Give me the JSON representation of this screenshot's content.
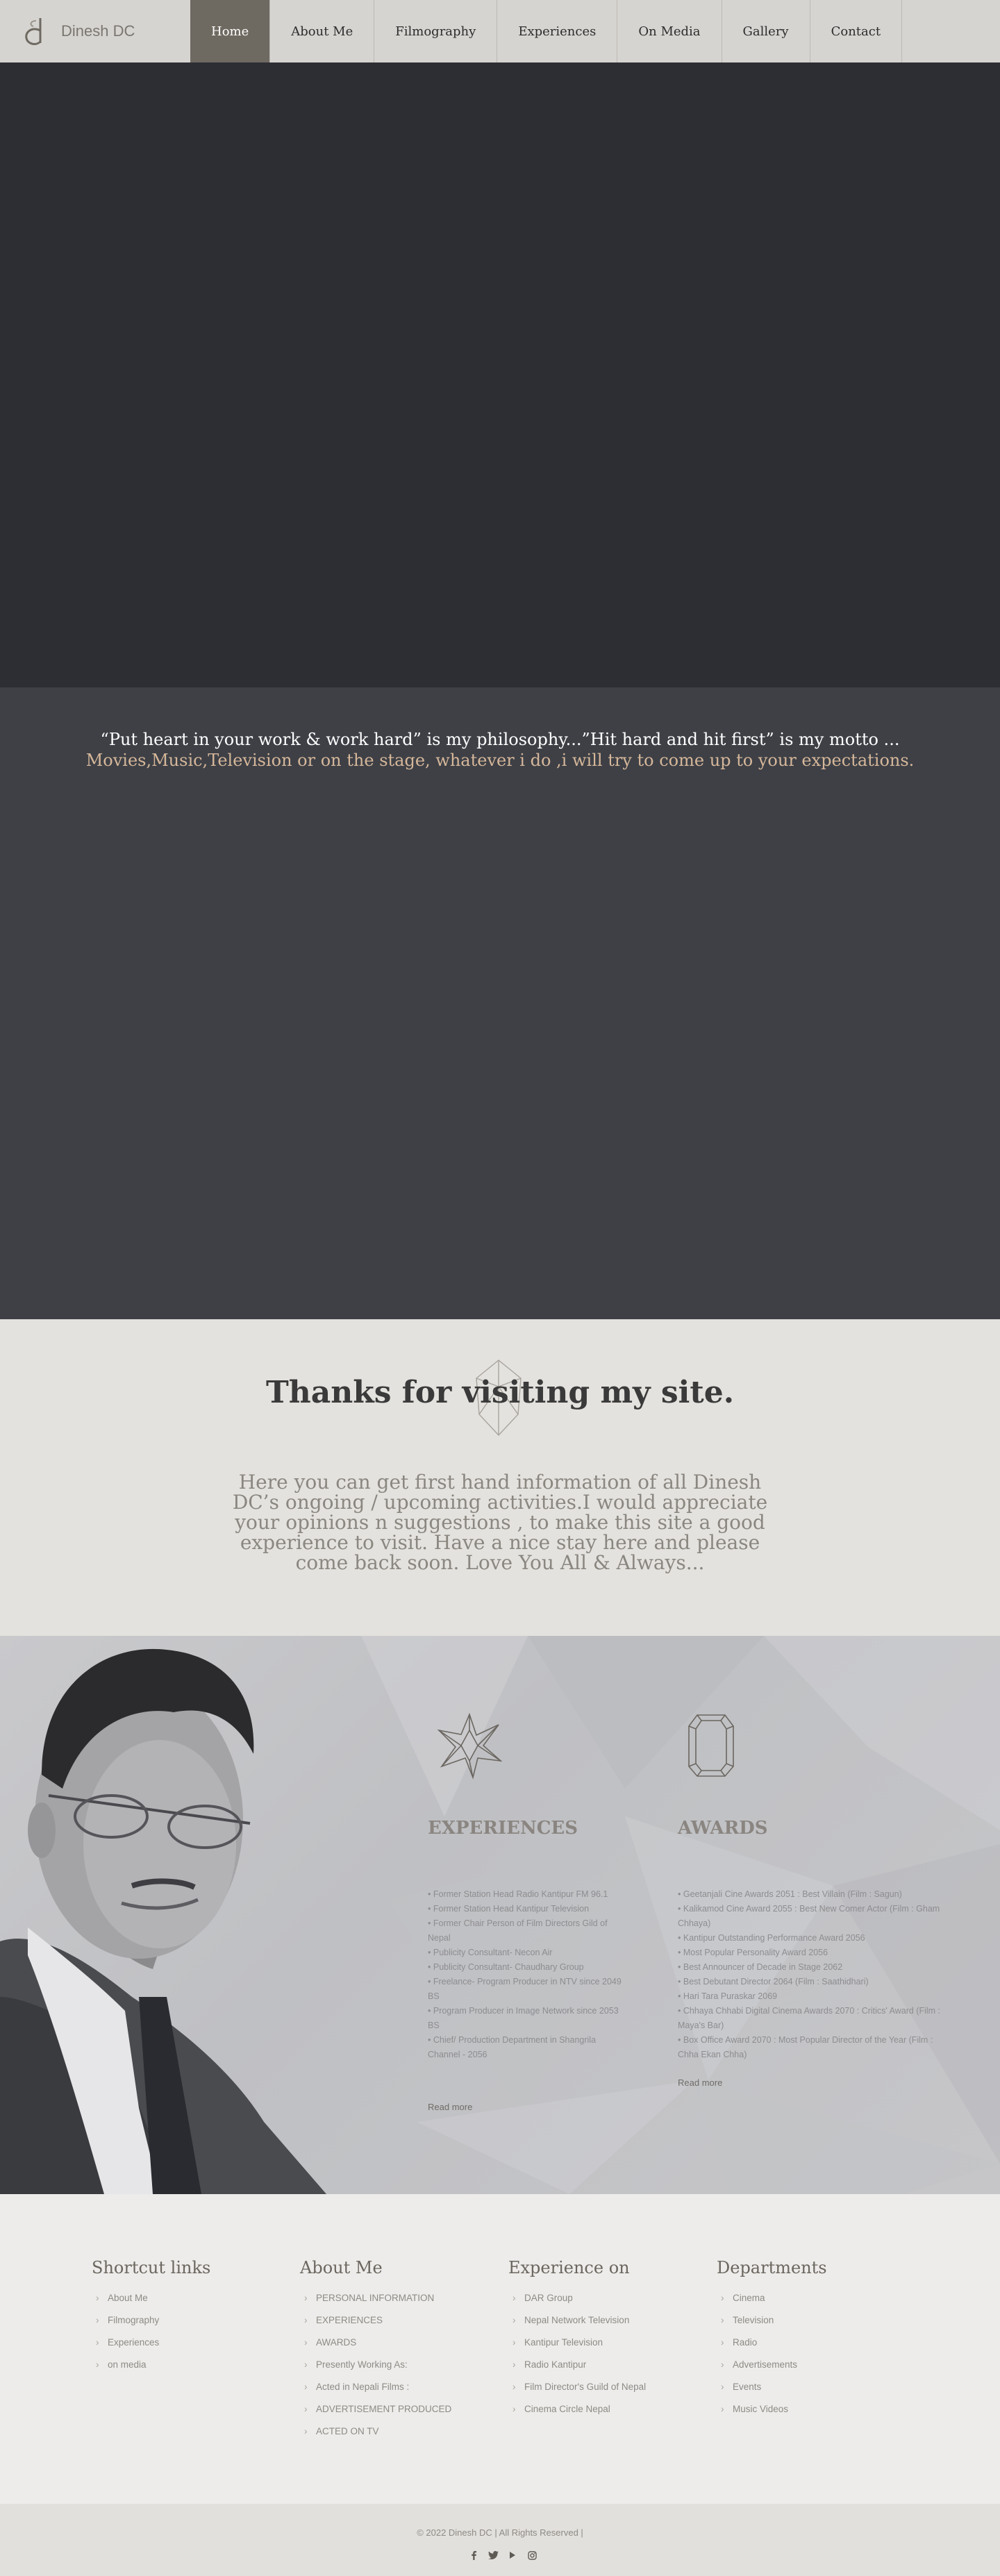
{
  "brand": {
    "name": "Dinesh DC",
    "logo_icon": "dc-monogram-icon"
  },
  "nav": {
    "items": [
      {
        "label": "Home",
        "active": true
      },
      {
        "label": "About Me"
      },
      {
        "label": "Filmography"
      },
      {
        "label": "Experiences"
      },
      {
        "label": "On Media"
      },
      {
        "label": "Gallery"
      },
      {
        "label": "Contact"
      }
    ]
  },
  "quote": {
    "main": "“Put heart in your work & work hard” is my philosophy...”Hit hard and hit first” is my motto ...",
    "accent": " Movies,Music,Television or on the stage, whatever i do ,i will try to come up to your expectations."
  },
  "thanks": {
    "title": "Thanks for visiting my site.",
    "body": "Here you can get first hand information of all Dinesh DC’s ongoing / upcoming activities.I would appreciate your opinions n suggestions , to make this site a good experience to visit. Have a nice stay here and please come back soon. Love You All & Always..."
  },
  "experiences": {
    "title": "EXPERIENCES",
    "icon": "star-burst-icon",
    "items": [
      "Former Station Head Radio Kantipur FM 96.1",
      "Former Station Head Kantipur Television",
      "Former Chair Person of Film Directors Gild of Nepal",
      "Publicity Consultant- Necon Air",
      "Publicity Consultant- Chaudhary Group",
      "Freelance- Program Producer in NTV since 2049 BS",
      "Program Producer in Image Network since 2053 BS",
      "Chief/ Production Department in Shangrila Channel - 2056"
    ],
    "read_more": "Read more"
  },
  "awards": {
    "title": "AWARDS",
    "icon": "gem-icon",
    "items": [
      "Geetanjali Cine Awards 2051 : Best Villain (Film : Sagun)",
      "Kalikamod Cine Award 2055 : Best New Comer Actor (Film : Gham Chhaya)",
      "Kantipur Outstanding Performance Award 2056",
      "Most Popular Personality Award 2056",
      "Best Announcer of Decade in Stage 2062",
      "Best Debutant Director 2064 (Film : Saathidhari)",
      "Hari Tara Puraskar 2069",
      "Chhaya Chhabi Digital Cinema Awards 2070 : Critics' Award (Film : Maya's Bar)",
      "Box Office Award 2070 : Most Popular Director of the Year (Film : Chha Ekan Chha)"
    ],
    "read_more": "Read more"
  },
  "footer": {
    "columns": [
      {
        "title": "Shortcut links",
        "items": [
          "About Me",
          "Filmography",
          "Experiences",
          "on media"
        ]
      },
      {
        "title": "About Me",
        "items": [
          "PERSONAL INFORMATION",
          "EXPERIENCES",
          "AWARDS",
          "Presently Working As:",
          "Acted in Nepali Films :",
          "ADVERTISEMENT PRODUCED",
          "ACTED ON TV"
        ]
      },
      {
        "title": "Experience on",
        "items": [
          "DAR Group",
          "Nepal Network Television",
          "Kantipur Television",
          "Radio Kantipur",
          "Film Director's Guild of Nepal",
          "Cinema Circle Nepal"
        ]
      },
      {
        "title": "Departments",
        "items": [
          "Cinema",
          "Television",
          "Radio",
          "Advertisements",
          "Events",
          "Music Videos"
        ]
      }
    ],
    "copyright": "© 2022 Dinesh DC | All Rights Reserved |",
    "socials": [
      "facebook-icon",
      "twitter-icon",
      "youtube-icon",
      "instagram-icon"
    ]
  },
  "colors": {
    "nav_active": "#6f6a61",
    "hero_dark": "#2d2e34",
    "quote_bg": "#3e4046",
    "accent": "#d6b79a"
  }
}
